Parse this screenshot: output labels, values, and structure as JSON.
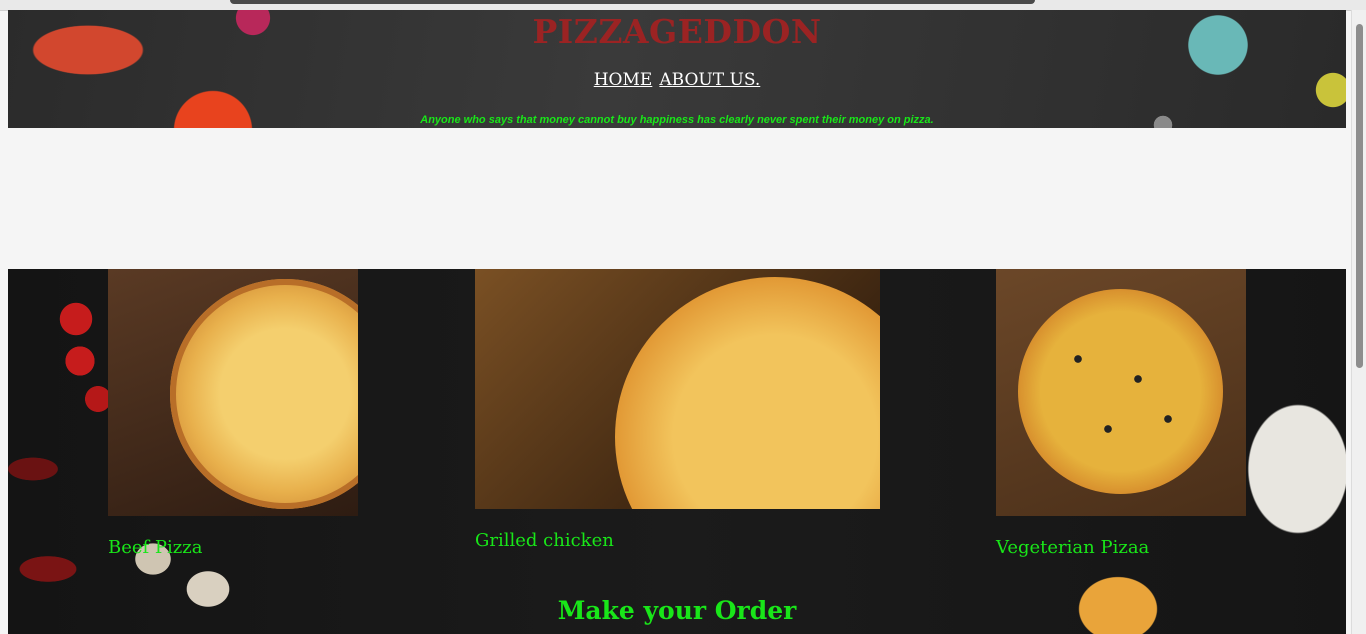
{
  "header": {
    "title": "PIZZAGEDDON",
    "nav": [
      {
        "label": "HOME"
      },
      {
        "label": "ABOUT US."
      }
    ],
    "tagline": "Anyone who says that money cannot buy happiness has clearly never spent their money on pizza."
  },
  "menu": {
    "items": [
      {
        "name": "Beef Pizza"
      },
      {
        "name": "Grilled chicken"
      },
      {
        "name": "Vegeterian Pizaa"
      }
    ],
    "order_heading": "Make your Order"
  },
  "colors": {
    "title": "#9b2323",
    "accent_green": "#19e619",
    "nav_link": "#ffffff"
  }
}
